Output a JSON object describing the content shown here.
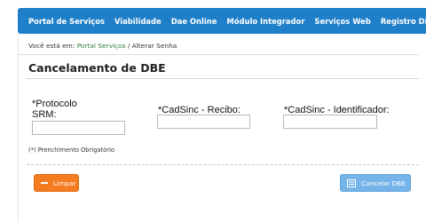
{
  "nav": {
    "items": [
      {
        "label": "Portal de Serviços"
      },
      {
        "label": "Viabilidade"
      },
      {
        "label": "Dae Online"
      },
      {
        "label": "Módulo Integrador"
      },
      {
        "label": "Serviços Web"
      },
      {
        "label": "Registro Digital"
      }
    ]
  },
  "breadcrumb": {
    "prefix": "Você está em: ",
    "link": "Portal Serviços",
    "current": " / Alterar Senha"
  },
  "page": {
    "title": "Cancelamento de DBE"
  },
  "form": {
    "protocolo": {
      "label": "*Protocolo\nSRM:",
      "value": ""
    },
    "recibo": {
      "label": "*CadSinc - Recibo:",
      "value": ""
    },
    "identificador": {
      "label": "*CadSinc - Identificador:",
      "value": ""
    },
    "required_note": "(*) Prenchimento Obrigatório"
  },
  "actions": {
    "clear_label": "Limpar",
    "cancel_label": "Cancelar DBE",
    "colors": {
      "clear": "#f47b20",
      "cancel": "#75b4e8",
      "nav": "#1f7fc9"
    }
  },
  "icons": {
    "clear": "minus-icon",
    "cancel": "document-icon"
  }
}
